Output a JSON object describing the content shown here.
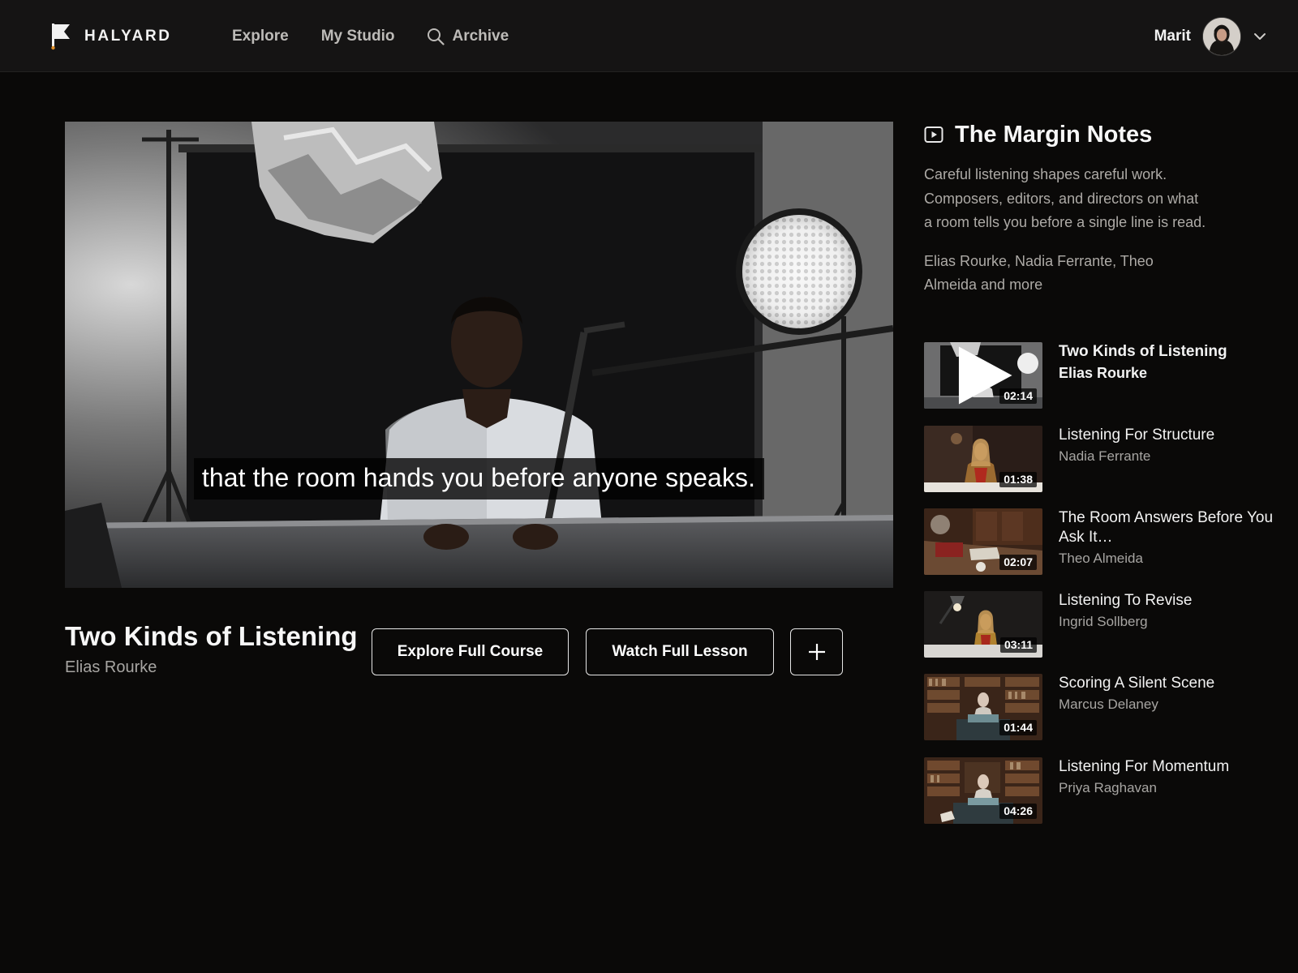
{
  "brand": {
    "name": "HALYARD"
  },
  "nav": {
    "items": [
      {
        "label": "Explore"
      },
      {
        "label": "My Studio"
      },
      {
        "label": "Archive",
        "icon": "search-icon"
      }
    ]
  },
  "user": {
    "name": "Marit"
  },
  "video": {
    "caption": "that the room hands you before anyone speaks."
  },
  "lesson": {
    "title": "Two Kinds of Listening",
    "author": "Elias Rourke",
    "explore_label": "Explore Full Course",
    "watch_label": "Watch Full Lesson",
    "add_label": "+"
  },
  "series": {
    "icon": "play-square-icon",
    "title": "The Margin Notes",
    "description": "Careful listening shapes careful work. Composers, editors, and directors on what a room tells you before a single line is read.",
    "contributors": "Elias Rourke, Nadia Ferrante, Theo Almeida and more"
  },
  "playlist": [
    {
      "title": "Two Kinds of Listening",
      "author": "Elias Rourke",
      "duration": "02:14",
      "active": true
    },
    {
      "title": "Listening For Structure",
      "author": "Nadia Ferrante",
      "duration": "01:38",
      "active": false
    },
    {
      "title": "The Room Answers Before You Ask It…",
      "author": "Theo Almeida",
      "duration": "02:07",
      "active": false
    },
    {
      "title": "Listening To Revise",
      "author": "Ingrid Sollberg",
      "duration": "03:11",
      "active": false
    },
    {
      "title": "Scoring A Silent Scene",
      "author": "Marcus Delaney",
      "duration": "01:44",
      "active": false
    },
    {
      "title": "Listening For Momentum",
      "author": "Priya Raghavan",
      "duration": "04:26",
      "active": false
    }
  ],
  "colors": {
    "background": "#0a0908",
    "header": "#151414",
    "muted_text": "#a7a5a2",
    "button_border": "#e6e6e6"
  }
}
